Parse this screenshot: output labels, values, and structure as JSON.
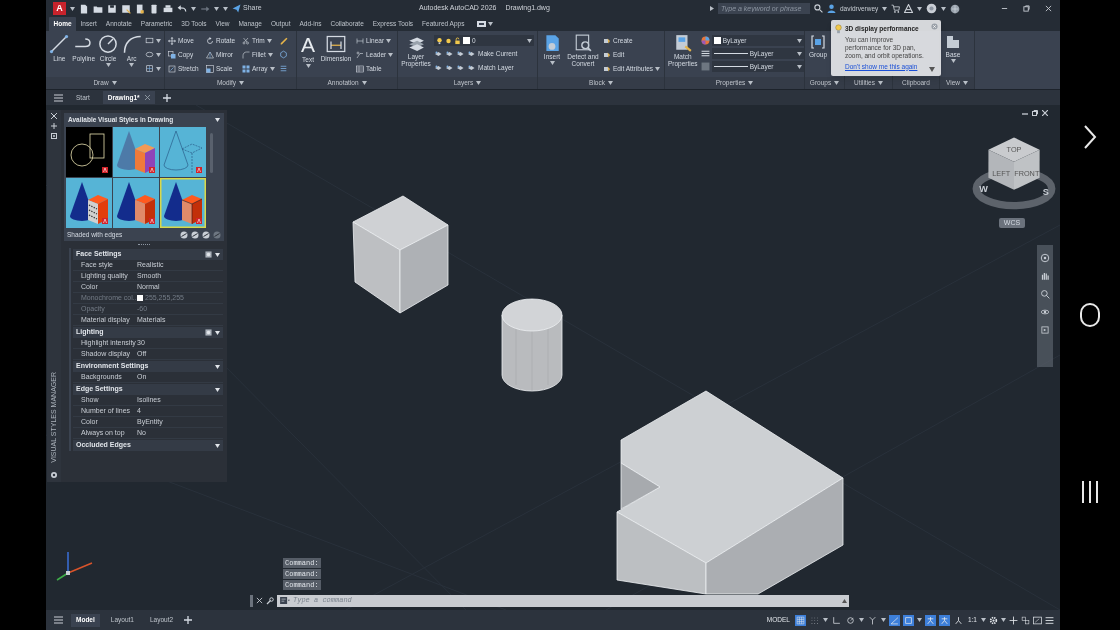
{
  "title_bar": {
    "app_glyph": "A",
    "share": "Share",
    "app_title": "Autodesk AutoCAD 2026",
    "file_title": "Drawing1.dwg",
    "search_placeholder": "Type a keyword or phrase",
    "user": "davidrverwey"
  },
  "ribbon_tabs": [
    {
      "label": "Home",
      "selected": true
    },
    {
      "label": "Insert",
      "selected": false
    },
    {
      "label": "Annotate",
      "selected": false
    },
    {
      "label": "Parametric",
      "selected": false
    },
    {
      "label": "3D Tools",
      "selected": false
    },
    {
      "label": "View",
      "selected": false
    },
    {
      "label": "Manage",
      "selected": false
    },
    {
      "label": "Output",
      "selected": false
    },
    {
      "label": "Add-ins",
      "selected": false
    },
    {
      "label": "Collaborate",
      "selected": false
    },
    {
      "label": "Express Tools",
      "selected": false
    },
    {
      "label": "Featured Apps",
      "selected": false
    }
  ],
  "ribbon_panels": [
    {
      "kind": "draw",
      "title": "Draw",
      "menu": true,
      "big": [
        {
          "label": "Line",
          "dropdown": false
        },
        {
          "label": "Polyline",
          "dropdown": false
        },
        {
          "label": "Circle",
          "dropdown": true
        },
        {
          "label": "Arc",
          "dropdown": true
        }
      ]
    },
    {
      "kind": "modify",
      "title": "Modify",
      "menu": true,
      "tools": [
        [
          {
            "label": "Move",
            "dropdown": false
          },
          {
            "label": "Rotate",
            "dropdown": false
          },
          {
            "label": "Trim",
            "dropdown": true
          }
        ],
        [
          {
            "label": "Copy",
            "dropdown": false
          },
          {
            "label": "Mirror",
            "dropdown": false
          },
          {
            "label": "Fillet",
            "dropdown": true
          }
        ],
        [
          {
            "label": "Stretch",
            "dropdown": false
          },
          {
            "label": "Scale",
            "dropdown": false
          },
          {
            "label": "Array",
            "dropdown": true
          }
        ]
      ]
    },
    {
      "kind": "annotation",
      "title": "Annotation",
      "menu": true,
      "big": [
        {
          "label": "Text",
          "glyph": "A",
          "dropdown": true
        },
        {
          "label": "Dimension",
          "dropdown": false
        }
      ],
      "tools": [
        [
          {
            "label": "Linear",
            "dropdown": true
          }
        ],
        [
          {
            "label": "Leader",
            "dropdown": true
          }
        ],
        [
          {
            "label": "Table",
            "dropdown": false
          }
        ]
      ]
    },
    {
      "kind": "layers",
      "title": "Layers",
      "menu": true,
      "big": [
        {
          "label": "Layer Properties",
          "dropdown": false
        }
      ],
      "layer": "0",
      "tools": [
        [
          {
            "label": "Make Current",
            "dropdown": false
          }
        ],
        [
          {
            "label": "Match Layer",
            "dropdown": false
          }
        ]
      ]
    },
    {
      "kind": "block",
      "title": "Block",
      "menu": true,
      "big": [
        {
          "label": "Insert",
          "dropdown": true
        },
        {
          "label": "Detect and Convert",
          "dropdown": false
        }
      ],
      "tools": [
        [
          {
            "label": "Create",
            "dropdown": false
          }
        ],
        [
          {
            "label": "Edit",
            "dropdown": false
          }
        ],
        [
          {
            "label": "Edit Attributes",
            "dropdown": true
          }
        ]
      ]
    },
    {
      "kind": "properties",
      "title": "Properties",
      "menu": true,
      "big": [
        {
          "label": "Match Properties",
          "dropdown": false
        }
      ],
      "dropdowns": [
        {
          "kind": "color",
          "value": "ByLayer"
        },
        {
          "kind": "linetype",
          "value": "ByLayer"
        },
        {
          "kind": "lineweight",
          "value": "ByLayer"
        }
      ]
    },
    {
      "kind": "groups",
      "title": "Groups",
      "menu": true,
      "big": [
        {
          "label": "Group",
          "dropdown": false
        }
      ]
    },
    {
      "kind": "utilities",
      "title": "Utilities",
      "menu": true
    },
    {
      "kind": "clipboard",
      "title": "Clipboard",
      "menu": false
    },
    {
      "kind": "view",
      "title": "View",
      "menu": true,
      "big": [
        {
          "label": "Base",
          "dropdown": true
        }
      ]
    }
  ],
  "tooltip": {
    "title": "3D display performance",
    "body": "You can improve performance for 3D pan, zoom, and orbit operations.",
    "link": "Don't show me this again"
  },
  "file_tabs": [
    {
      "label": "Start",
      "selected": false,
      "closable": false
    },
    {
      "label": "Drawing1*",
      "selected": true,
      "closable": true
    }
  ],
  "palette": {
    "title": "VISUAL STYLES MANAGER",
    "header": "Available Visual Styles in Drawing",
    "styles": [
      {
        "kind": "wireframe2d",
        "selected": false
      },
      {
        "kind": "conceptual",
        "selected": false
      },
      {
        "kind": "hidden",
        "selected": false
      },
      {
        "kind": "xray",
        "selected": false
      },
      {
        "kind": "shaded",
        "selected": false
      },
      {
        "kind": "shaded_edges",
        "selected": true
      }
    ],
    "current_style": "Shaded with edges",
    "sections": [
      {
        "title": "Face Settings",
        "tool_icon": true,
        "rows": [
          {
            "label": "Face style",
            "value": "Realistic",
            "disabled": false
          },
          {
            "label": "Lighting quality",
            "value": "Smooth",
            "disabled": false
          },
          {
            "label": "Color",
            "value": "Normal",
            "disabled": false
          },
          {
            "label": "Monochrome col...",
            "value": "255,255,255",
            "color": "#ffffff",
            "disabled": true
          },
          {
            "label": "Opacity",
            "value": "-60",
            "disabled": true
          },
          {
            "label": "Material display",
            "value": "Materials",
            "disabled": false
          }
        ]
      },
      {
        "title": "Lighting",
        "tool_icon": true,
        "rows": [
          {
            "label": "Highlight intensity",
            "value": "30",
            "disabled": false
          },
          {
            "label": "Shadow display",
            "value": "Off",
            "disabled": false
          }
        ]
      },
      {
        "title": "Environment Settings",
        "tool_icon": false,
        "rows": [
          {
            "label": "Backgrounds",
            "value": "On",
            "disabled": false
          }
        ]
      },
      {
        "title": "Edge Settings",
        "tool_icon": false,
        "rows": [
          {
            "label": "Show",
            "value": "Isolines",
            "disabled": false
          },
          {
            "label": "Number of lines",
            "value": "4",
            "disabled": false
          },
          {
            "label": "Color",
            "value": "ByEntity",
            "disabled": false
          },
          {
            "label": "Always on top",
            "value": "No",
            "disabled": false
          }
        ]
      },
      {
        "title": "Occluded Edges",
        "tool_icon": false
      }
    ]
  },
  "viewcube": {
    "faces": [
      "TOP",
      "LEFT",
      "FRONT"
    ],
    "compass": [
      "W",
      "S"
    ],
    "ucs": "WCS"
  },
  "command_history": [
    "Command:",
    "Command:",
    "Command:"
  ],
  "command_placeholder": "Type a command",
  "layout_tabs": [
    {
      "label": "Model",
      "selected": true
    },
    {
      "label": "Layout1",
      "selected": false
    },
    {
      "label": "Layout2",
      "selected": false
    }
  ],
  "status": {
    "space": "MODEL",
    "toggles": [
      {
        "on": true
      },
      {
        "on": false
      },
      {
        "on": false
      },
      {
        "on": false
      },
      {
        "on": false
      },
      {
        "on": true
      },
      {
        "on": true
      },
      {
        "on": true
      },
      {
        "on": true
      },
      {
        "on": false
      }
    ],
    "scale": "1:1"
  }
}
